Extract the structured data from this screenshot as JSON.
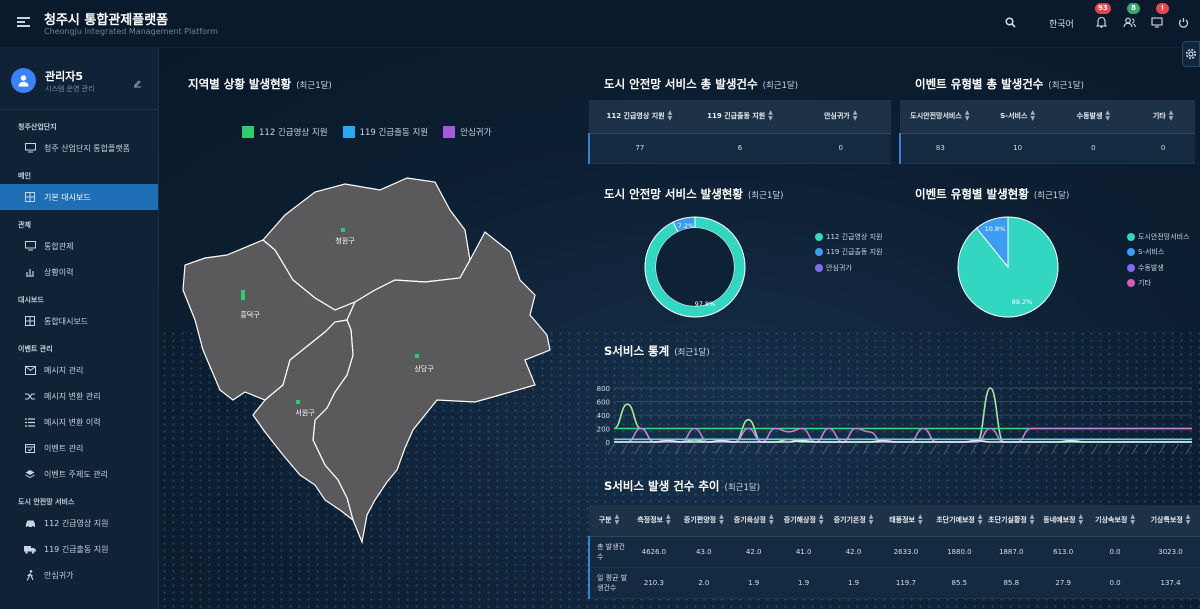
{
  "header": {
    "title": "청주시 통합관제플랫폼",
    "subtitle": "Cheongju Integrated Management Platform",
    "language": "한국어",
    "badges": {
      "notifications": "93",
      "users": "8",
      "monitor": "!"
    }
  },
  "user": {
    "name": "관리자5",
    "role": "시스템 운영 관리"
  },
  "sidebar": [
    {
      "section": "청주산업단지",
      "items": [
        {
          "label": "청주 산업단지 통합플랫폼",
          "icon": "monitor-icon"
        }
      ]
    },
    {
      "section": "메인",
      "items": [
        {
          "label": "기본 대시보드",
          "icon": "grid-icon",
          "active": true
        }
      ]
    },
    {
      "section": "관제",
      "items": [
        {
          "label": "통합관제",
          "icon": "monitor-icon"
        },
        {
          "label": "상황이력",
          "icon": "chart-icon"
        }
      ]
    },
    {
      "section": "대시보드",
      "items": [
        {
          "label": "통합대시보드",
          "icon": "grid-icon"
        }
      ]
    },
    {
      "section": "이벤트 관리",
      "items": [
        {
          "label": "메시지 관리",
          "icon": "mail-icon"
        },
        {
          "label": "메시지 변환 관리",
          "icon": "shuffle-icon"
        },
        {
          "label": "메시지 변환 이력",
          "icon": "list-icon"
        },
        {
          "label": "이벤트 관리",
          "icon": "calendar-icon"
        },
        {
          "label": "이벤트 주제도 관리",
          "icon": "layers-icon"
        }
      ]
    },
    {
      "section": "도시 안전망 서비스",
      "items": [
        {
          "label": "112 긴급영상 지원",
          "icon": "car-icon"
        },
        {
          "label": "119 긴급출동 지원",
          "icon": "truck-icon"
        },
        {
          "label": "안심귀가",
          "icon": "walk-icon"
        }
      ]
    }
  ],
  "map_panel": {
    "title": "지역별 상황 발생현황",
    "period": "(최근1달)",
    "legend": [
      {
        "label": "112 긴급영상 지원",
        "color": "#2ecc71"
      },
      {
        "label": "119 긴급출동 지원",
        "color": "#29a8f0"
      },
      {
        "label": "안심귀가",
        "color": "#a45bd6"
      }
    ],
    "districts": [
      "청원구",
      "흥덕구",
      "상당구",
      "서원구"
    ]
  },
  "safety_total": {
    "title": "도시 안전망 서비스 총 발생건수",
    "period": "(최근1달)",
    "headers": [
      "112 긴급영상 지원",
      "119 긴급출동 지원",
      "안심귀가"
    ],
    "values": [
      "77",
      "6",
      "0"
    ]
  },
  "event_total": {
    "title": "이벤트 유형별 총 발생건수",
    "period": "(최근1달)",
    "headers": [
      "도시안전망서비스",
      "S-서비스",
      "수동발생",
      "기타"
    ],
    "values": [
      "83",
      "10",
      "0",
      "0"
    ]
  },
  "safety_status": {
    "title": "도시 안전망 서비스 발생현황",
    "period": "(최근1달)",
    "legend": [
      {
        "label": "112 긴급영상 지원",
        "color": "#33d6c0"
      },
      {
        "label": "119 긴급출동 지원",
        "color": "#3b9cf0"
      },
      {
        "label": "안심귀가",
        "color": "#7b6cf0"
      }
    ],
    "labels": [
      "7.2%",
      "97.8%"
    ]
  },
  "event_status": {
    "title": "이벤트 유형별 발생현황",
    "period": "(최근1달)",
    "legend": [
      {
        "label": "도시안전망서비스",
        "color": "#33d6c0"
      },
      {
        "label": "S-서비스",
        "color": "#3b9cf0"
      },
      {
        "label": "수동발생",
        "color": "#7b6cf0"
      },
      {
        "label": "기타",
        "color": "#d65bb4"
      }
    ],
    "labels": [
      "10.8%",
      "89.2%"
    ]
  },
  "chart_data": [
    {
      "type": "pie",
      "title": "도시 안전망 서비스 발생현황",
      "categories": [
        "112 긴급영상 지원",
        "119 긴급출동 지원",
        "안심귀가"
      ],
      "values": [
        92.8,
        7.2,
        0
      ],
      "labels": [
        "97.8%",
        "7.2%"
      ],
      "legend": "right"
    },
    {
      "type": "pie",
      "title": "이벤트 유형별 발생현황",
      "categories": [
        "도시안전망서비스",
        "S-서비스",
        "수동발생",
        "기타"
      ],
      "values": [
        89.2,
        10.8,
        0,
        0
      ],
      "labels": [
        "89.2%",
        "10.8%"
      ],
      "legend": "right"
    },
    {
      "type": "line",
      "title": "S서비스 통계",
      "yticks": [
        "800",
        "600",
        "400",
        "200",
        "0"
      ],
      "ylim": [
        0,
        800
      ],
      "grid": true,
      "series": [
        {
          "color": "#a8e6a0",
          "values": [
            200,
            560,
            200,
            0,
            0,
            0,
            30,
            0,
            0,
            0,
            330,
            0,
            0,
            40,
            0,
            0,
            0,
            0,
            0,
            0,
            0,
            0,
            0,
            0,
            0,
            0,
            0,
            0,
            800,
            0,
            0,
            0,
            0,
            0,
            0,
            0,
            0,
            0,
            0,
            0,
            0,
            0,
            0,
            0
          ]
        },
        {
          "color": "#2ee07a",
          "values": [
            200,
            200,
            200,
            200,
            200,
            200,
            200,
            200,
            200,
            200,
            200,
            200,
            200,
            200,
            200,
            200,
            200,
            200,
            200,
            200,
            200,
            200,
            200,
            200,
            200,
            200,
            200,
            200,
            200,
            200,
            200,
            200,
            200,
            200,
            200,
            200,
            200,
            200,
            200,
            200,
            200,
            200,
            200,
            200
          ]
        },
        {
          "color": "#c77ad6",
          "values": [
            0,
            0,
            200,
            0,
            0,
            0,
            200,
            0,
            0,
            0,
            200,
            0,
            200,
            150,
            200,
            0,
            200,
            0,
            200,
            150,
            0,
            0,
            0,
            200,
            0,
            0,
            0,
            0,
            200,
            0,
            0,
            200,
            200,
            200,
            200,
            200,
            200,
            200,
            200,
            200,
            200,
            200,
            200,
            200
          ]
        },
        {
          "color": "#e8eef6",
          "values": [
            0,
            0,
            0,
            0,
            20,
            0,
            0,
            0,
            20,
            0,
            0,
            0,
            0,
            0,
            20,
            0,
            0,
            0,
            0,
            0,
            20,
            0,
            0,
            0,
            0,
            0,
            0,
            20,
            0,
            0,
            0,
            0,
            0,
            0,
            20,
            0,
            0,
            0,
            0,
            0,
            0,
            0,
            0,
            0
          ]
        },
        {
          "color": "#5fd3e6",
          "values": [
            40,
            40,
            40,
            40,
            40,
            40,
            40,
            40,
            40,
            40,
            40,
            40,
            40,
            40,
            40,
            40,
            40,
            40,
            40,
            40,
            40,
            40,
            40,
            40,
            40,
            40,
            40,
            40,
            40,
            40,
            40,
            40,
            40,
            40,
            40,
            40,
            40,
            40,
            40,
            40,
            40,
            40,
            40,
            40
          ]
        }
      ]
    }
  ],
  "s_stats": {
    "title": "S서비스 통계",
    "period": "(최근1달)"
  },
  "trend": {
    "title": "S서비스 발생 건수 추이",
    "period": "(최근1달)",
    "headers": [
      "구분",
      "측정정보",
      "증기편양정",
      "증기육상정",
      "증기해상정",
      "증기기온정",
      "태풍정보",
      "초단기예보정",
      "초단기실황정",
      "동네예보정",
      "기상속보정",
      "기상특보정"
    ],
    "rows": [
      [
        "총 발생건수",
        "4626.0",
        "43.0",
        "42.0",
        "41.0",
        "42.0",
        "2633.0",
        "1880.0",
        "1887.0",
        "613.0",
        "0.0",
        "3023.0"
      ],
      [
        "일 평균 발생건수",
        "210.3",
        "2.0",
        "1.9",
        "1.9",
        "1.9",
        "119.7",
        "85.5",
        "85.8",
        "27.9",
        "0.0",
        "137.4"
      ]
    ]
  }
}
